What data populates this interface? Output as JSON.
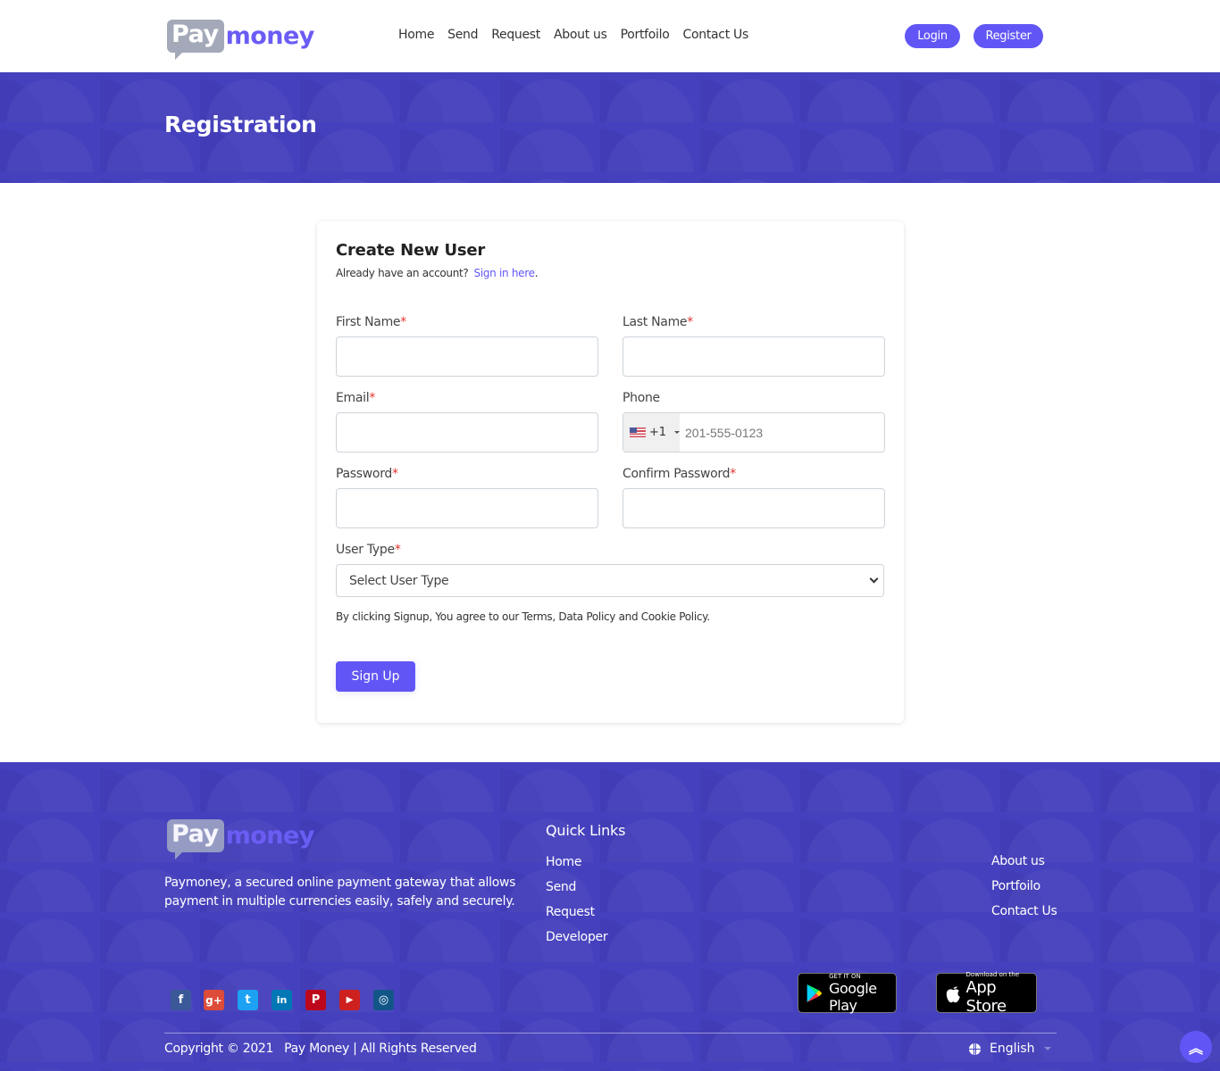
{
  "header": {
    "logo": {
      "part1": "Pay",
      "part2": "money"
    },
    "nav": [
      {
        "label": "Home"
      },
      {
        "label": "Send"
      },
      {
        "label": "Request"
      },
      {
        "label": "About us"
      },
      {
        "label": "Portfoilo"
      },
      {
        "label": "Contact Us"
      }
    ],
    "login_label": "Login",
    "register_label": "Register"
  },
  "banner": {
    "title": "Registration"
  },
  "form": {
    "title": "Create New User",
    "already_text": "Already have an account?",
    "signin_link": "Sign in here",
    "signin_suffix": ".",
    "required_mark": "*",
    "first_name": {
      "label": "First Name",
      "value": ""
    },
    "last_name": {
      "label": "Last Name",
      "value": ""
    },
    "email": {
      "label": "Email",
      "value": ""
    },
    "phone": {
      "label": "Phone",
      "country_code": "+1",
      "country": "US",
      "placeholder": "201-555-0123",
      "value": ""
    },
    "password": {
      "label": "Password",
      "value": ""
    },
    "confirm_password": {
      "label": "Confirm Password",
      "value": ""
    },
    "user_type": {
      "label": "User Type",
      "selected": "Select User Type"
    },
    "terms": "By clicking Signup, You agree to our Terms, Data Policy and Cookie Policy.",
    "submit_label": "Sign Up"
  },
  "footer": {
    "logo": {
      "part1": "Pay",
      "part2": "money"
    },
    "description": "Paymoney, a secured online payment gateway that allows payment in multiple currencies easily, safely and securely.",
    "quick_links_title": "Quick Links",
    "quick_links": [
      {
        "label": "Home"
      },
      {
        "label": "Send"
      },
      {
        "label": "Request"
      },
      {
        "label": "Developer"
      }
    ],
    "more_links": [
      {
        "label": "About us"
      },
      {
        "label": "Portfoilo"
      },
      {
        "label": "Contact Us"
      }
    ],
    "social": [
      {
        "name": "facebook",
        "glyph": "f",
        "color": "#3b5998"
      },
      {
        "name": "google-plus",
        "glyph": "g+",
        "color": "#dd4b39"
      },
      {
        "name": "twitter",
        "glyph": "t",
        "color": "#1da1f2"
      },
      {
        "name": "linkedin",
        "glyph": "in",
        "color": "#0077b5"
      },
      {
        "name": "pinterest",
        "glyph": "P",
        "color": "#bd081c"
      },
      {
        "name": "youtube",
        "glyph": "▶",
        "color": "#cd201f"
      },
      {
        "name": "instagram",
        "glyph": "◎",
        "color": "#125688"
      }
    ],
    "google_play": {
      "small": "GET IT ON",
      "big": "Google Play"
    },
    "app_store": {
      "small": "Download on the",
      "big": "App Store"
    },
    "copyright": "Copyright © 2021",
    "rights": "Pay Money | All Rights Reserved",
    "language": "English"
  }
}
